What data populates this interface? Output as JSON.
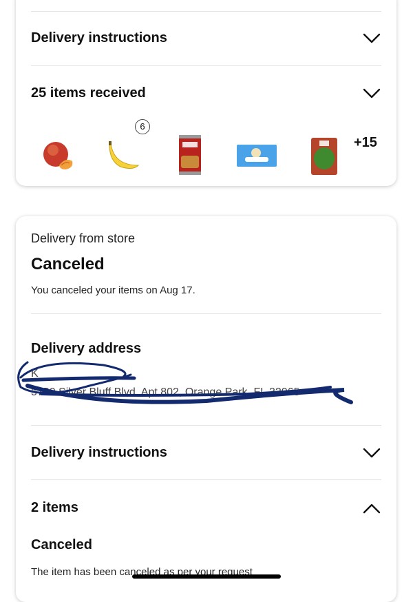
{
  "card1": {
    "delivery_instructions_label": "Delivery instructions",
    "items_received_label": "25 items received",
    "thumbnails": [
      {
        "name": "peach"
      },
      {
        "name": "banana",
        "badge": "6"
      },
      {
        "name": "hunts-can"
      },
      {
        "name": "snuggle-sheets"
      },
      {
        "name": "spinach-bag"
      }
    ],
    "more_count": "+15"
  },
  "card2": {
    "delivery_type": "Delivery from store",
    "status": "Canceled",
    "status_note": "You canceled your items on Aug 17.",
    "address_heading": "Delivery address",
    "address_name": "K",
    "address_line": "5750 Silver Bluff Blvd. Apt 802, Orange Park, FL 32065",
    "delivery_instructions_label": "Delivery instructions",
    "items_label": "2 items",
    "canceled_heading": "Canceled",
    "canceled_note": "The item has been canceled as per your request"
  },
  "colors": {
    "scribble": "#142a6e",
    "card_shadow": "#d0d0d0"
  },
  "icons": {
    "chevron_down": "chevron-down-icon",
    "chevron_up": "chevron-up-icon"
  }
}
